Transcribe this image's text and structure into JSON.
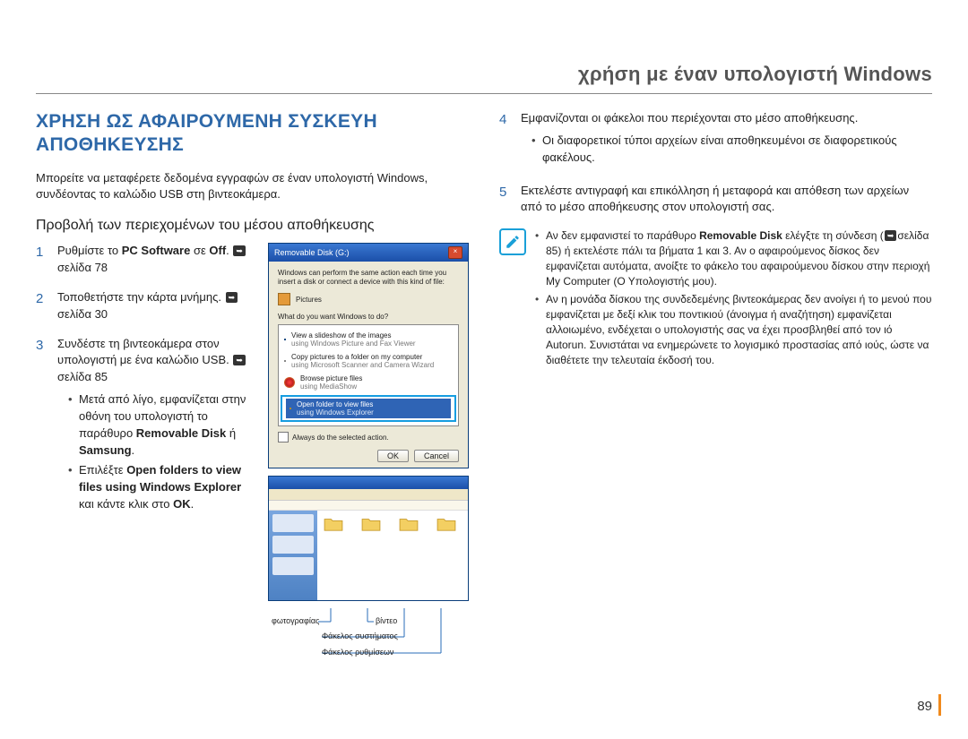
{
  "header": {
    "title": "χρήση με έναν υπολογιστή Windows"
  },
  "left": {
    "section_title": "ΧΡΗΣΗ ΩΣ ΑΦΑΙΡΟΥΜΕΝΗ ΣΥΣΚΕΥΗ ΑΠΟΘΗΚΕΥΣΗΣ",
    "intro": "Μπορείτε να μεταφέρετε δεδομένα εγγραφών σε έναν υπολογιστή Windows, συνδέοντας το καλώδιο USB στη βιντεοκάμερα.",
    "subhead": "Προβολή των περιεχομένων του μέσου αποθήκευσης",
    "steps": {
      "s1": {
        "num": "1",
        "pre": "Ρυθμίστε το ",
        "bold1": "PC Software",
        "mid": " σε ",
        "bold2": "Off",
        "post": ". ",
        "pageref": "σελίδα 78"
      },
      "s2": {
        "num": "2",
        "text": "Τοποθετήστε την κάρτα μνήμης. ",
        "pageref": "σελίδα 30"
      },
      "s3": {
        "num": "3",
        "text": "Συνδέστε τη βιντεοκάμερα στον υπολογιστή με ένα καλώδιο USB. ",
        "pageref": "σελίδα 85",
        "b1": {
          "pre": "Μετά από λίγο, εμφανίζεται στην οθόνη του υπολογιστή το παράθυρο ",
          "bold1": "Removable Disk",
          "mid": " ή ",
          "bold2": "Samsung",
          "post": "."
        },
        "b2": {
          "pre": "Επιλέξτε ",
          "bold1": "Open folders to view files using Windows Explorer",
          "mid": " και κάντε κλικ στο ",
          "bold2": "OK",
          "post": "."
        }
      }
    },
    "dialog": {
      "title": "Removable Disk (G:)",
      "body1": "Windows can perform the same action each time you insert a disk or connect a device with this kind of file:",
      "pictures": "Pictures",
      "prompt": "What do you want Windows to do?",
      "opt1a": "View a slideshow of the images",
      "opt1b": "using Windows Picture and Fax Viewer",
      "opt2a": "Copy pictures to a folder on my computer",
      "opt2b": "using Microsoft Scanner and Camera Wizard",
      "opt3a": "Browse picture files",
      "opt3b": "using MediaShow",
      "opt4a": "Open folder to view files",
      "opt4b": "using Windows Explorer",
      "always": "Always do the selected action.",
      "ok": "OK",
      "cancel": "Cancel"
    },
    "callouts": {
      "photo": "φωτογραφίας",
      "video": "βίντεο",
      "system": "Φάκελος συστήματος",
      "settings": "Φάκελος ρυθμίσεων"
    }
  },
  "right": {
    "steps": {
      "s4": {
        "num": "4",
        "text": "Εμφανίζονται οι φάκελοι που περιέχονται στο μέσο αποθήκευσης.",
        "b1": "Οι διαφορετικοί τύποι αρχείων είναι αποθηκευμένοι σε διαφορετικούς φακέλους."
      },
      "s5": {
        "num": "5",
        "text": "Εκτελέστε αντιγραφή και επικόλληση ή μεταφορά και απόθεση των αρχείων από το μέσο αποθήκευσης στον υπολογιστή σας."
      }
    },
    "note": {
      "b1": {
        "pre": "Αν δεν εμφανιστεί το παράθυρο ",
        "bold": "Removable Disk",
        "post": " ελέγξτε τη σύνδεση (",
        "pageref": "σελίδα 85",
        "post2": ") ή εκτελέστε πάλι τα βήματα 1 και 3. Αν ο αφαιρούμενος δίσκος δεν εμφανίζεται αυτόματα, ανοίξτε το φάκελο του αφαιρούμενου δίσκου στην περιοχή My Computer (Ο Υπολογιστής μου)."
      },
      "b2": "Αν η μονάδα δίσκου της συνδεδεμένης βιντεοκάμερας δεν ανοίγει ή το μενού που εμφανίζεται με δεξί κλικ του ποντικιού (άνοιγμα ή αναζήτηση) εμφανίζεται αλλοιωμένο, ενδέχεται ο υπολογιστής σας να έχει προσβληθεί από τον ιό Autorun. Συνιστάται να ενημερώνετε το λογισμικό προστασίας από ιούς, ώστε να διαθέτετε την τελευταία έκδοσή του."
    }
  },
  "page_number": "89"
}
